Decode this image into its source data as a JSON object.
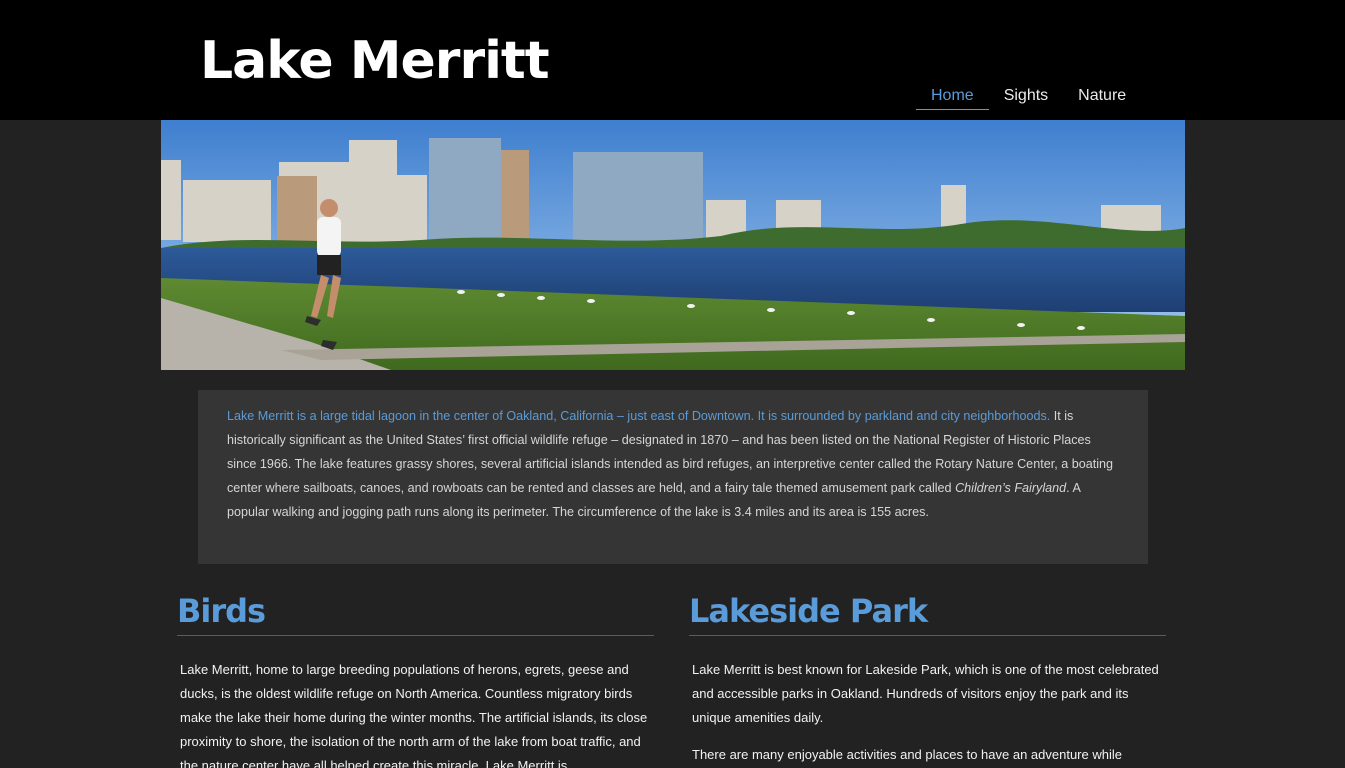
{
  "site": {
    "title": "Lake Merritt"
  },
  "nav": {
    "items": [
      {
        "label": "Home",
        "active": true
      },
      {
        "label": "Sights",
        "active": false
      },
      {
        "label": "Nature",
        "active": false
      }
    ]
  },
  "hero": {
    "alt": "Runner on the path along Lake Merritt with the Oakland skyline"
  },
  "intro": {
    "lead": "Lake Merritt is a large tidal lagoon in the center of Oakland, California – just east of Downtown. It is surrounded by parkland and city neighborhoods.",
    "body_before": " It is historically significant as the United States’ first official wildlife refuge – designated in 1870 – and has been listed on the National Register of Historic Places since 1966. The lake features grassy shores, several artificial islands intended as bird refuges, an interpretive center called the Rotary Nature Center, a boating center where sailboats, canoes, and rowboats can be rented and classes are held, and a fairy tale themed amusement park called ",
    "emphasis": "Children’s Fairyland",
    "body_after": ". A popular walking and jogging path runs along its perimeter. The circumference of the lake is 3.4 miles and its area is 155 acres."
  },
  "sections": {
    "birds": {
      "heading": "Birds",
      "paragraphs": [
        "Lake Merritt, home to large breeding populations of herons, egrets, geese and ducks, is the oldest wildlife refuge on North America. Countless migratory birds make the lake their home during the winter months. The artificial islands, its close proximity to shore, the isolation of the north arm of the lake from boat traffic, and the nature center have all helped create this miracle. Lake Merritt is"
      ]
    },
    "lakeside": {
      "heading": "Lakeside Park",
      "paragraphs": [
        "Lake Merritt is best known for Lakeside Park, which is one of the most celebrated and accessible parks in Oakland. Hundreds of visitors enjoy the park and its unique amenities daily.",
        "There are many enjoyable activities and places to have an adventure while"
      ]
    }
  },
  "colors": {
    "page_bg": "#222222",
    "header_bg": "#000000",
    "accent": "#5a9bd9",
    "intro_bg": "#353535"
  }
}
